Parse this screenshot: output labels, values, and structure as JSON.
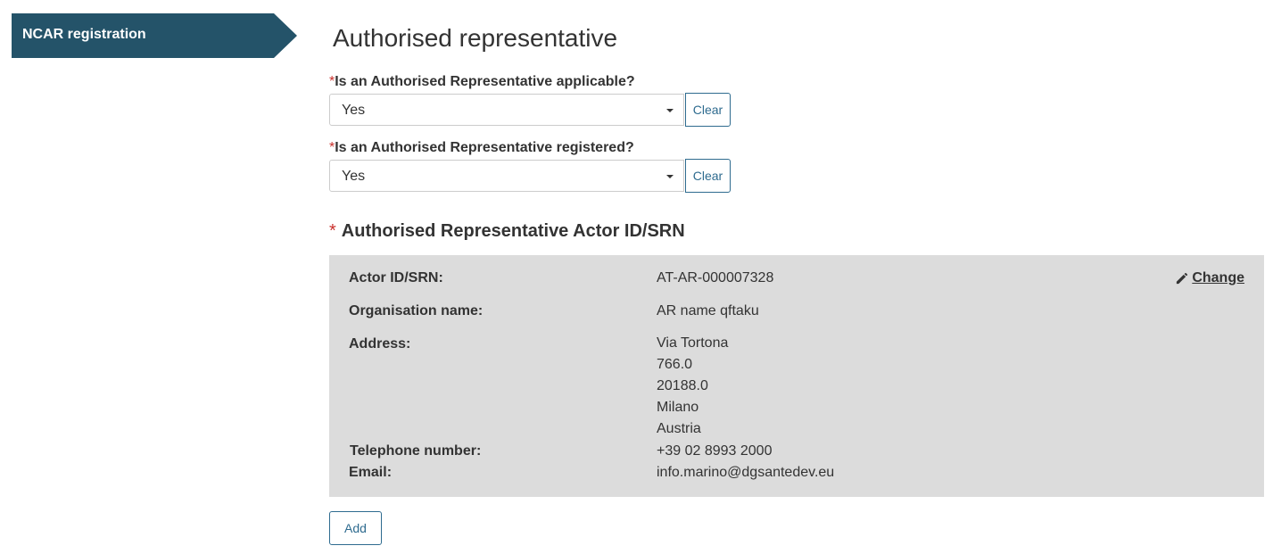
{
  "nav": {
    "step_label": "NCAR registration"
  },
  "page": {
    "title": "Authorised representative"
  },
  "fields": [
    {
      "required_mark": "*",
      "label": "Is an Authorised Representative applicable?",
      "value": "Yes",
      "clear_label": "Clear"
    },
    {
      "required_mark": "*",
      "label": "Is an Authorised Representative registered?",
      "value": "Yes",
      "clear_label": "Clear"
    }
  ],
  "actor_section": {
    "required_mark": "*",
    "heading": "Authorised Representative Actor ID/SRN",
    "change_label": "Change",
    "change_icon": "pencil-icon",
    "actor_id_label": "Actor ID/SRN:",
    "actor_id": "AT-AR-000007328",
    "org_label": "Organisation name:",
    "org_name": "AR name qftaku",
    "address_label": "Address:",
    "address_lines": [
      "Via Tortona",
      "766.0",
      "20188.0",
      "Milano",
      "Austria"
    ],
    "telephone_label": "Telephone number:",
    "telephone": "+39 02 8993 2000",
    "email_label": "Email:",
    "email": "info.marino@dgsantedev.eu"
  },
  "add_label": "Add",
  "colors": {
    "brand": "#245369",
    "accent": "#2e6b8f",
    "panel": "#dcdcdc",
    "required": "#c9302c"
  }
}
